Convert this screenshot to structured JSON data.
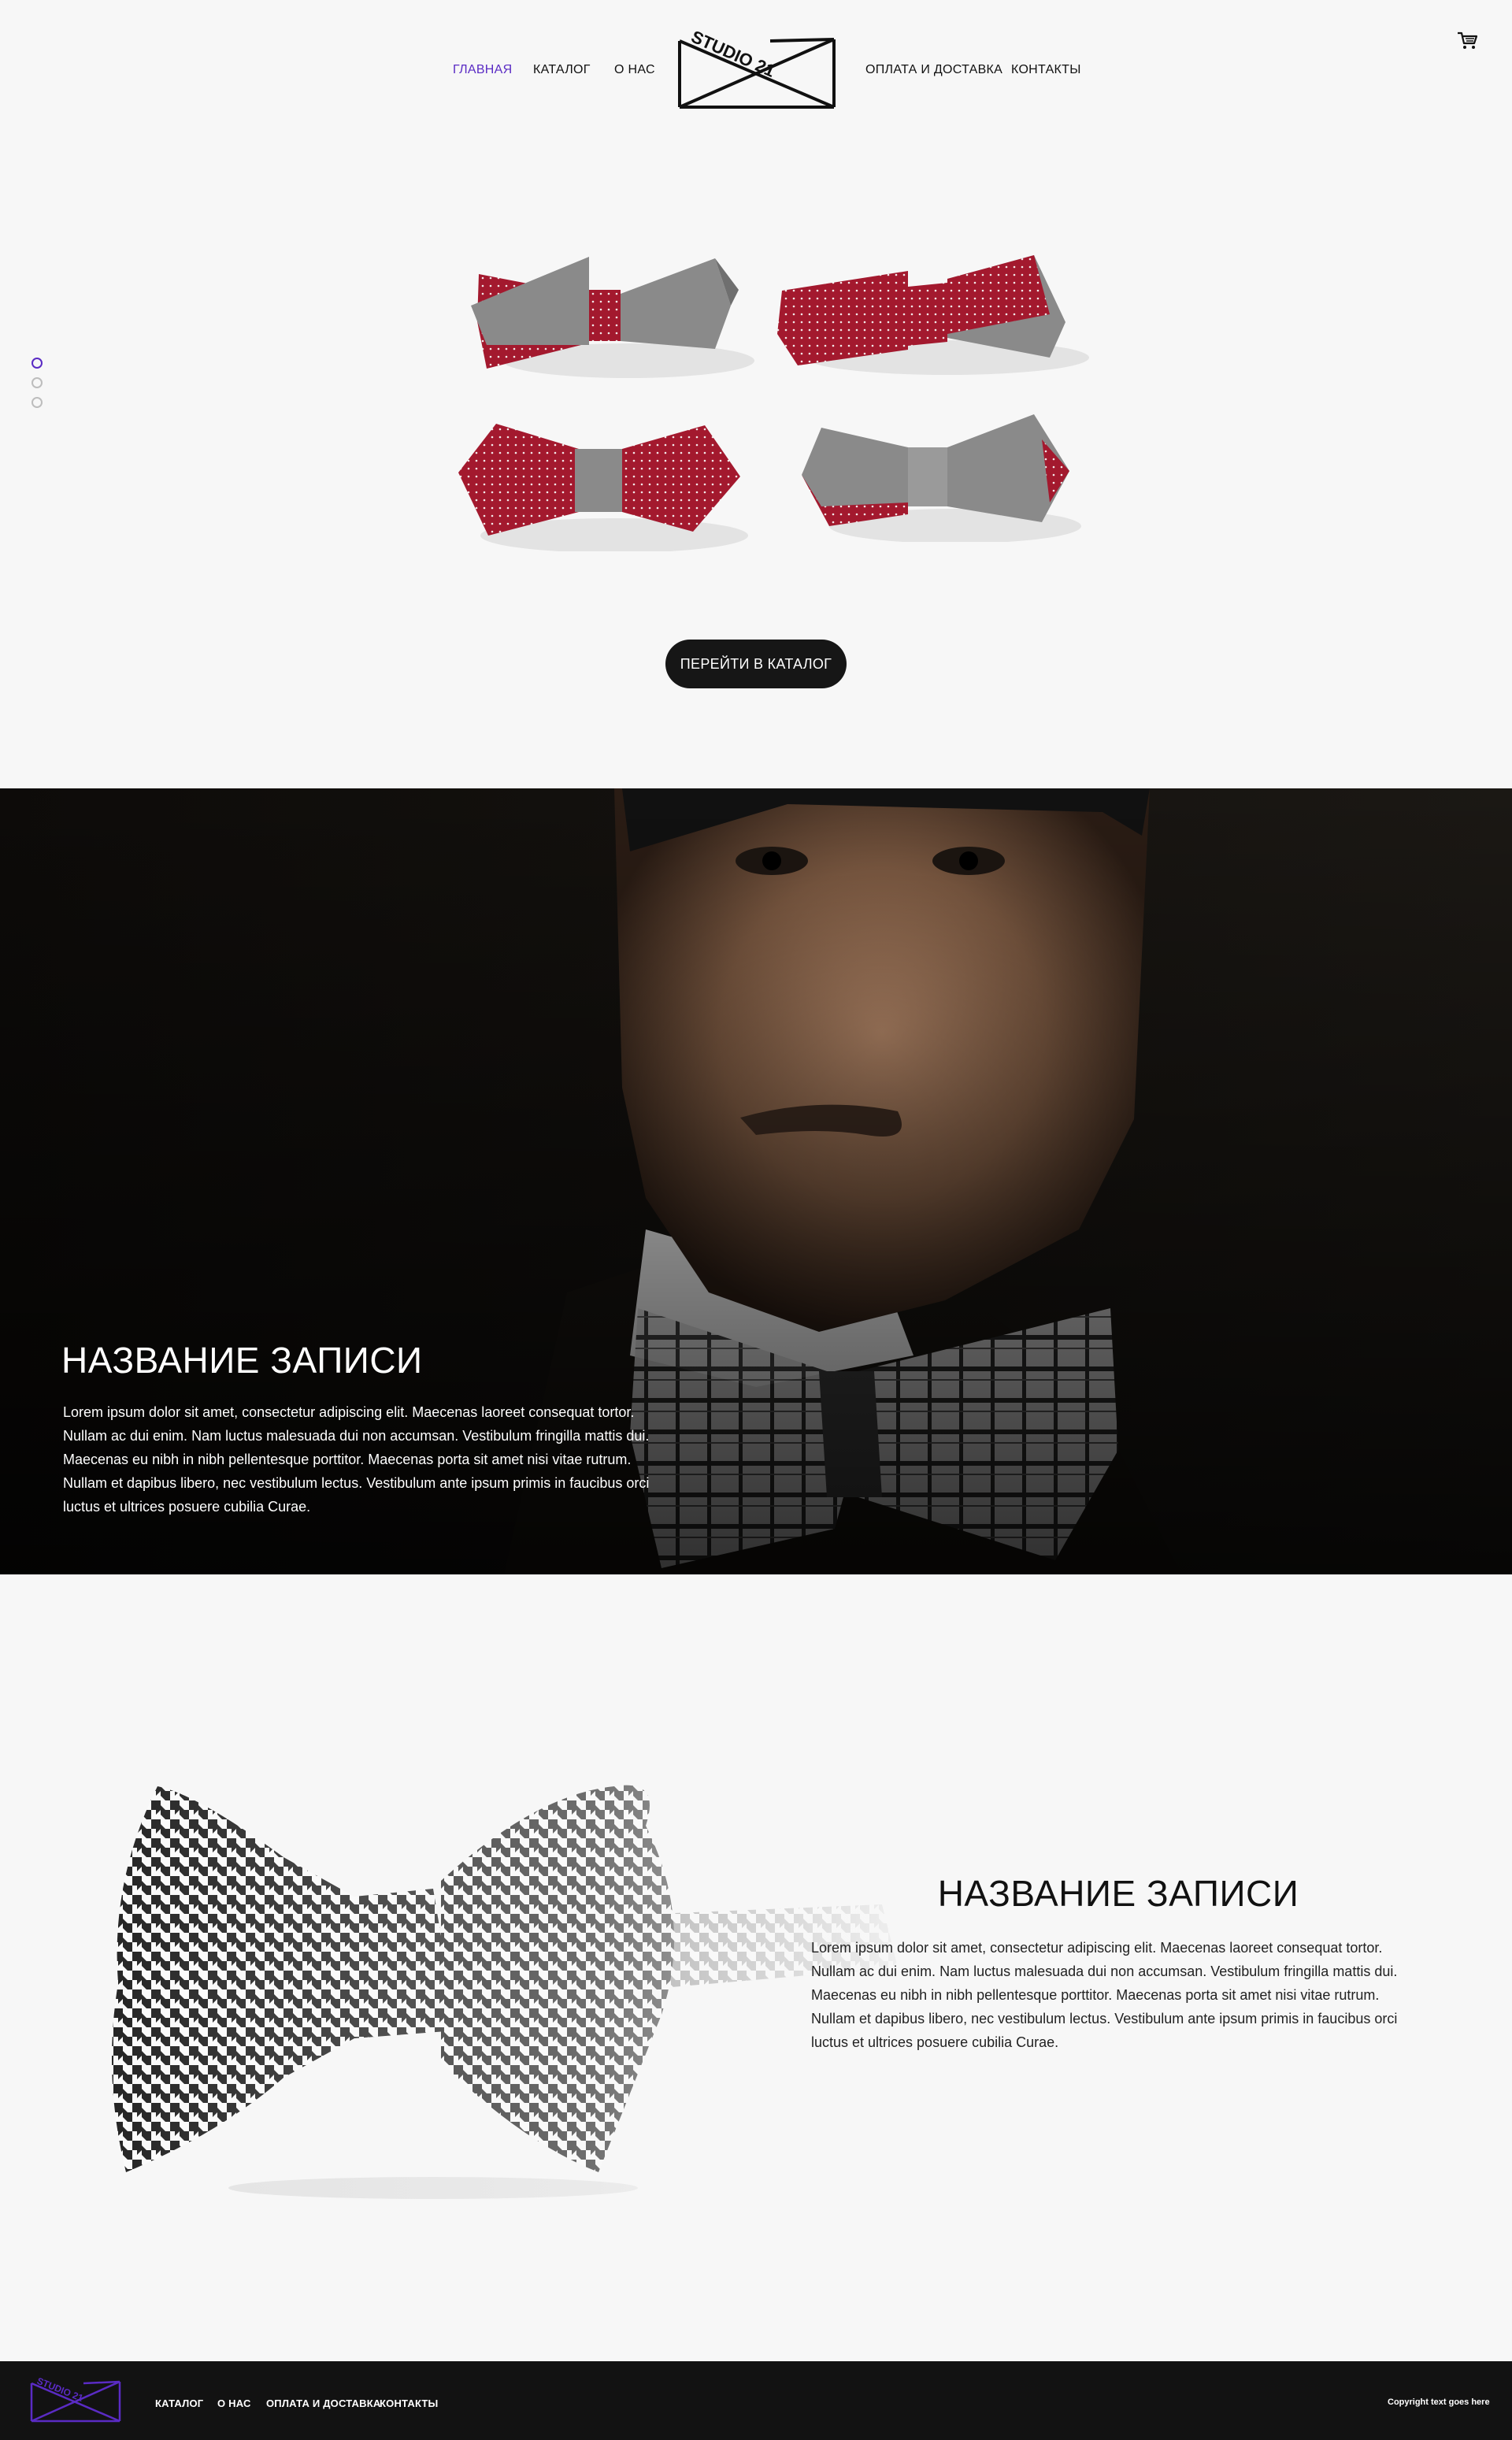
{
  "header": {
    "nav_left": [
      "Главная",
      "Каталог",
      "О нас"
    ],
    "nav_right": [
      "Оплата и доставка",
      "Контакты"
    ],
    "logo_text": "STUDIO 21",
    "cart_icon": "cart-icon"
  },
  "slider": {
    "dots": 3,
    "active_dot": 0
  },
  "hero_products": {
    "button_label": "ПЕРЕЙТИ В КАТАЛОГ"
  },
  "feature_1": {
    "title": "НАЗВАНИЕ ЗАПИСИ",
    "text": "Lorem ipsum dolor sit amet, consectetur adipiscing elit. Maecenas laoreet consequat tortor. Nullam ac dui enim. Nam luctus malesuada dui non accumsan. Vestibulum fringilla mattis dui. Maecenas eu nibh in nibh pellentesque porttitor. Maecenas porta sit amet nisi vitae rutrum. Nullam et dapibus libero, nec vestibulum lectus. Vestibulum ante ipsum primis in faucibus orci luctus et ultrices posuere cubilia Curae."
  },
  "feature_2": {
    "title": "НАЗВАНИЕ ЗАПИСИ",
    "text": "Lorem ipsum dolor sit amet, consectetur adipiscing elit. Maecenas laoreet consequat tortor. Nullam ac dui enim. Nam luctus malesuada dui non accumsan. Vestibulum fringilla mattis dui. Maecenas eu nibh in nibh pellentesque porttitor. Maecenas porta sit amet nisi vitae rutrum. Nullam et dapibus libero, nec vestibulum lectus. Vestibulum ante ipsum primis in faucibus orci luctus et ultrices posuere cubilia Curae."
  },
  "footer": {
    "nav": [
      "Каталог",
      "О нас",
      "Оплата и доставка",
      "Контакты"
    ],
    "copyright": "Copyright text goes here",
    "logo_text": "STUDIO 21"
  },
  "colors": {
    "accent": "#5a2bc4",
    "dark": "#121212",
    "background": "#f7f7f7",
    "bowtie_red": "#a3192e",
    "bowtie_grey": "#7a7a7a"
  }
}
